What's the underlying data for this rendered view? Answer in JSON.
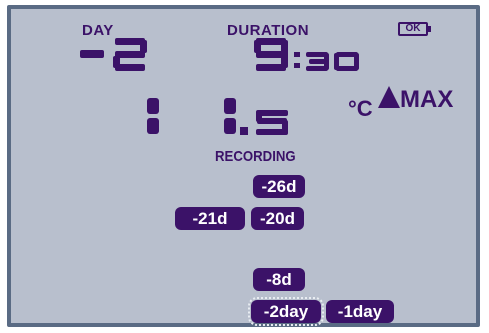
{
  "header": {
    "day_label": "DAY",
    "duration_label": "DURATION",
    "battery_status": "OK"
  },
  "day_value": "-2",
  "duration_value": "9:30",
  "temperature": {
    "value": "11.5",
    "unit": "°C",
    "mode": "MAX"
  },
  "status": {
    "recording_label": "RECORDING"
  },
  "history_badges": [
    {
      "label": "-26d"
    },
    {
      "label": "-21d"
    },
    {
      "label": "-20d"
    },
    {
      "label": "-8d"
    },
    {
      "label": "-2day",
      "selected": true
    },
    {
      "label": "-1day"
    }
  ],
  "colors": {
    "lcd_background": "#b8bfcd",
    "segment_ink": "#3b1268",
    "frame": "#5a6b84",
    "badge_text": "#ffffff"
  },
  "icons": {
    "battery": "battery-ok-icon",
    "max_arrow": "up-triangle-icon"
  }
}
